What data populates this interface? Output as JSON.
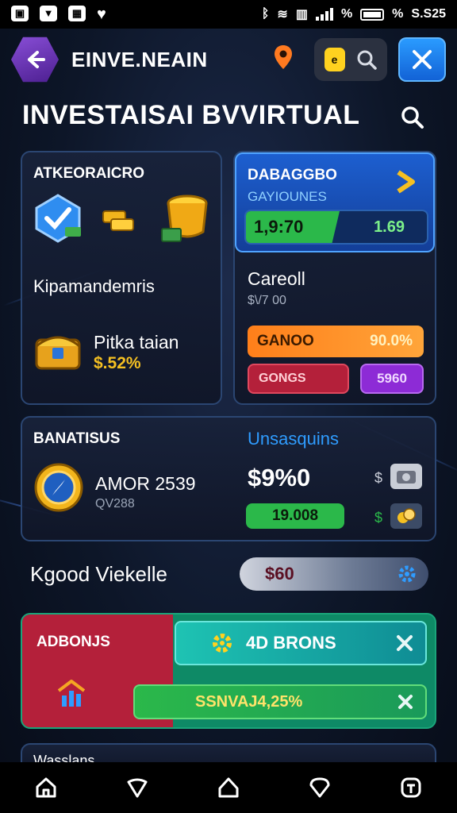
{
  "status_bar": {
    "left_icons": [
      "notification-icon",
      "notification-icon",
      "notification-icon",
      "heart-icon"
    ],
    "battery_text": "%",
    "percent_text": "%",
    "time": "S.S25"
  },
  "header": {
    "title": "EINVE.NEAIN",
    "coin_glyph": "e"
  },
  "page": {
    "title": "INVESTAISAI BVVIRTUAL"
  },
  "left_panel": {
    "heading": "ATKEORAICRO",
    "label_middle": "Kipamandemris",
    "item_name": "Pitka taian",
    "item_value": "$.52%"
  },
  "right_panel": {
    "title_top": "DABAGGBO",
    "subtitle": "GAYIOUNES",
    "bar_value_left": "1,9:70",
    "bar_value_right": "1.69",
    "label": "Careoll",
    "sublabel": "$\\/7 00",
    "orange_label": "GANOO",
    "orange_value": "90.0%",
    "red_label": "GONGS",
    "purple_value": "5960"
  },
  "mid_panel": {
    "heading": "BANATISUS",
    "right_heading": "Unsasquins",
    "item_name": "AMOR 2539",
    "item_sub": "QV288",
    "big_value": "$9%0",
    "green_value": "19.008",
    "dollar_top": "$",
    "dollar_bottom": "$"
  },
  "row": {
    "label": "Kgood Viekelle",
    "value": "$60"
  },
  "bottom_panel": {
    "left_label": "ADBONJS",
    "top_label": "4D BRONS",
    "bottom_value": "SSNVAJ4,25%"
  },
  "peek_panel": {
    "label": "Wasslans"
  },
  "colors": {
    "accent_blue": "#1f8bff",
    "green": "#2bb84a",
    "orange": "#ff8a1f",
    "red": "#b4203a",
    "purple": "#8d2bd6",
    "teal": "#1aa7a0",
    "gold": "#f5c022"
  }
}
